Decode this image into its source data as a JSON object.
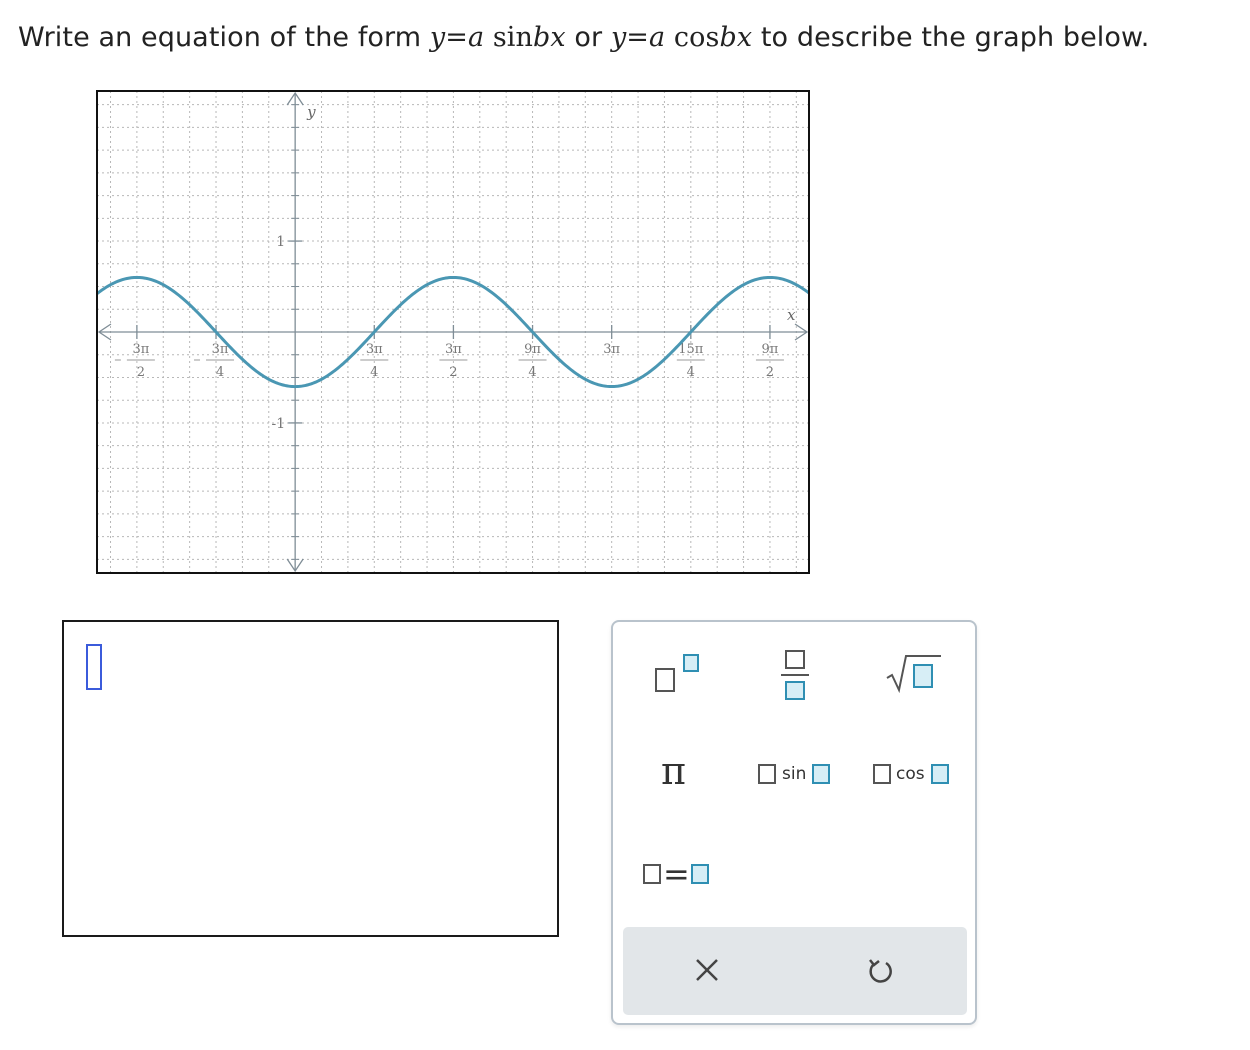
{
  "question": {
    "lead": "Write an equation of the form ",
    "form1": {
      "y": "y",
      "eq": "=",
      "a": "a",
      "fn": " sin",
      "b": "b",
      "x": "x"
    },
    "or": " or ",
    "form2": {
      "y": "y",
      "eq": "=",
      "a": "a",
      "fn": " cos",
      "b": "b",
      "x": "x"
    },
    "tail": " to describe the graph below."
  },
  "graph": {
    "axis_labels": {
      "x": "x",
      "y": "y"
    },
    "y_ticks": [
      {
        "value": 1,
        "label": "1"
      },
      {
        "value": -1,
        "label": "-1"
      }
    ],
    "x_ticks": [
      {
        "value": -4.71239,
        "num": "3π",
        "den": "2",
        "neg": true
      },
      {
        "value": -2.35619,
        "num": "3π",
        "den": "4",
        "neg": true
      },
      {
        "value": 2.35619,
        "num": "3π",
        "den": "4",
        "neg": false
      },
      {
        "value": 4.71239,
        "num": "3π",
        "den": "2",
        "neg": false
      },
      {
        "value": 7.06858,
        "num": "9π",
        "den": "4",
        "neg": false
      },
      {
        "value": 9.42478,
        "num": "3π",
        "den": "",
        "neg": false
      },
      {
        "value": 11.78097,
        "num": "15π",
        "den": "4",
        "neg": false
      },
      {
        "value": 14.13717,
        "num": "9π",
        "den": "2",
        "neg": false
      }
    ],
    "x_range": [
      -5.9,
      15.3
    ],
    "y_range": [
      -2.65,
      2.65
    ],
    "curve": {
      "type": "cosine",
      "amplitude": -0.6,
      "angular_frequency": 0.66667,
      "color": "#4a97b3"
    },
    "grid": true
  },
  "answer": {
    "value": ""
  },
  "palette": {
    "pi": "π",
    "sin_label": "sin",
    "cos_label": "cos",
    "equals": "=",
    "accent_color": "#2f8fb3"
  }
}
